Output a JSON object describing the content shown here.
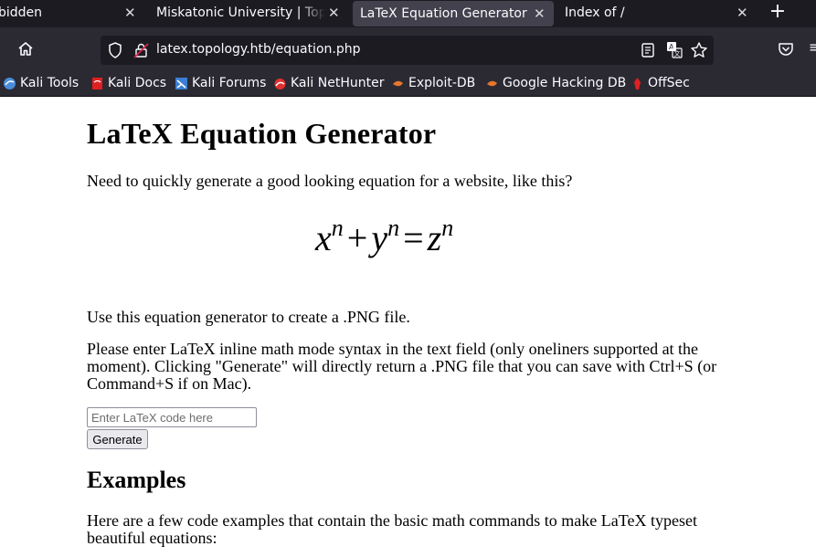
{
  "tabs": [
    {
      "label": "bidden"
    },
    {
      "label": "Miskatonic University | Topology"
    },
    {
      "label": "LaTeX Equation Generator"
    },
    {
      "label": "Index of /"
    }
  ],
  "new_tab_symbol": "+",
  "address_bar": {
    "url": "latex.topology.htb/equation.php"
  },
  "bookmarks": [
    {
      "label": "Kali Tools",
      "icon": "kali-icon",
      "color": "#4a8cd9"
    },
    {
      "label": "Kali Docs",
      "icon": "kali-docs-icon",
      "color": "#e02020"
    },
    {
      "label": "Kali Forums",
      "icon": "kali-forums-icon",
      "color": "#3b7fd4"
    },
    {
      "label": "Kali NetHunter",
      "icon": "nethunter-icon",
      "color": "#e03030"
    },
    {
      "label": "Exploit-DB",
      "icon": "exploitdb-icon",
      "color": "#e8762b"
    },
    {
      "label": "Google Hacking DB",
      "icon": "ghdb-icon",
      "color": "#e8762b"
    },
    {
      "label": "OffSec",
      "icon": "offsec-icon",
      "color": "#e02020"
    }
  ],
  "page": {
    "title": "LaTeX Equation Generator",
    "intro": "Need to quickly generate a good looking equation for a website, like this?",
    "equation": {
      "x": "x",
      "y": "y",
      "z": "z",
      "exp": "n",
      "plus": "+",
      "equals": "="
    },
    "use_text": "Use this equation generator to create a .PNG file.",
    "instructions": "Please enter LaTeX inline math mode syntax in the text field (only oneliners supported at the moment). Clicking \"Generate\" will directly return a .PNG file that you can save with Ctrl+S (or Command+S if on Mac).",
    "input_placeholder": "Enter LaTeX code here",
    "input_value": "",
    "generate_label": "Generate",
    "examples_heading": "Examples",
    "examples_text": "Here are a few code examples that contain the basic math commands to make LaTeX typeset beautiful equations:"
  },
  "colors": {
    "chrome_dark": "#1c1b22",
    "chrome": "#2b2a33",
    "active_tab": "#42414d"
  }
}
